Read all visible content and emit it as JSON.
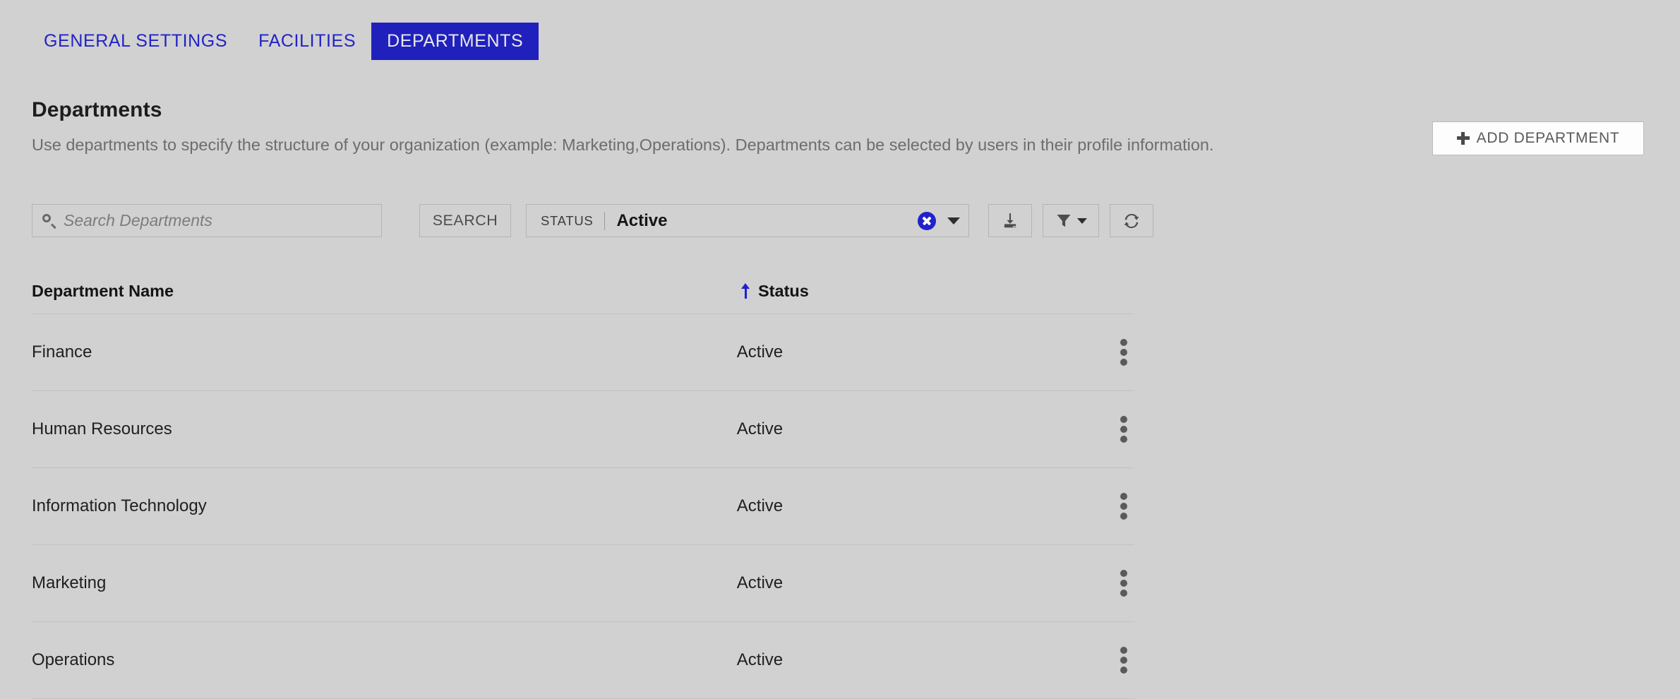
{
  "tabs": [
    {
      "label": "GENERAL SETTINGS",
      "active": false
    },
    {
      "label": "FACILITIES",
      "active": false
    },
    {
      "label": "DEPARTMENTS",
      "active": true
    }
  ],
  "header": {
    "title": "Departments",
    "description": "Use departments to specify the structure of your organization (example: Marketing,Operations). Departments can be selected by users in their profile information.",
    "add_button_label": "ADD DEPARTMENT"
  },
  "toolbar": {
    "search_placeholder": "Search Departments",
    "search_value": "",
    "search_button_label": "SEARCH",
    "status_filter": {
      "label": "STATUS",
      "value": "Active"
    },
    "export_title": "Export",
    "filter_title": "Filter",
    "refresh_title": "Refresh"
  },
  "table": {
    "columns": [
      "Department Name",
      "Status"
    ],
    "sort": {
      "column": "Status",
      "direction": "ascending"
    },
    "rows": [
      {
        "name": "Finance",
        "status": "Active"
      },
      {
        "name": "Human Resources",
        "status": "Active"
      },
      {
        "name": "Information Technology",
        "status": "Active"
      },
      {
        "name": "Marketing",
        "status": "Active"
      },
      {
        "name": "Operations",
        "status": "Active"
      }
    ]
  },
  "colors": {
    "background": "#d1d1d1",
    "accent_blue": "#2020bd",
    "tab_link_blue": "#2222c7",
    "active_tab_text": "#e8e8e8",
    "muted_text": "#6d6d6d",
    "border": "#b4b4b4",
    "divider": "#c2c2c2"
  }
}
